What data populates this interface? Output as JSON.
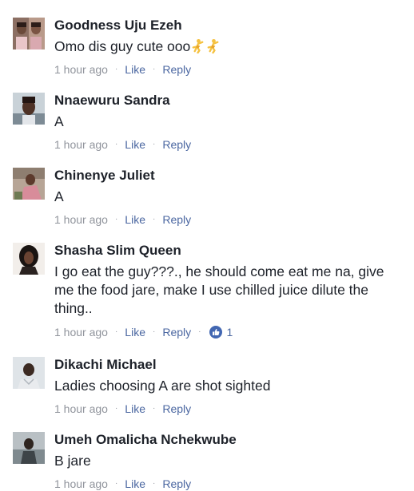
{
  "comments": [
    {
      "name": "Goodness Uju Ezeh",
      "text": "Omo dis guy cute ooo",
      "emoji": [
        "dancer-emoji",
        "dancer-emoji"
      ],
      "time": "1 hour ago",
      "like_label": "Like",
      "reply_label": "Reply"
    },
    {
      "name": "Nnaewuru Sandra",
      "text": "A",
      "time": "1 hour ago",
      "like_label": "Like",
      "reply_label": "Reply"
    },
    {
      "name": "Chinenye Juliet",
      "text": "A",
      "time": "1 hour ago",
      "like_label": "Like",
      "reply_label": "Reply"
    },
    {
      "name": "Shasha Slim Queen",
      "text": "I go eat the guy???., he should come eat me na, give me the food jare, make I use chilled juice dilute the thing..",
      "time": "1 hour ago",
      "like_label": "Like",
      "reply_label": "Reply",
      "like_count": "1"
    },
    {
      "name": "Dikachi Michael",
      "text": "Ladies choosing A are shot sighted",
      "time": "1 hour ago",
      "like_label": "Like",
      "reply_label": "Reply"
    },
    {
      "name": "Umeh Omalicha Nchekwube",
      "text": "B jare",
      "time": "1 hour ago",
      "like_label": "Like",
      "reply_label": "Reply"
    }
  ],
  "separator": "·",
  "colors": {
    "name_text": "#1d2129",
    "meta_text": "#90949c",
    "link": "#4b67a1",
    "like_badge": "#4267b2"
  }
}
